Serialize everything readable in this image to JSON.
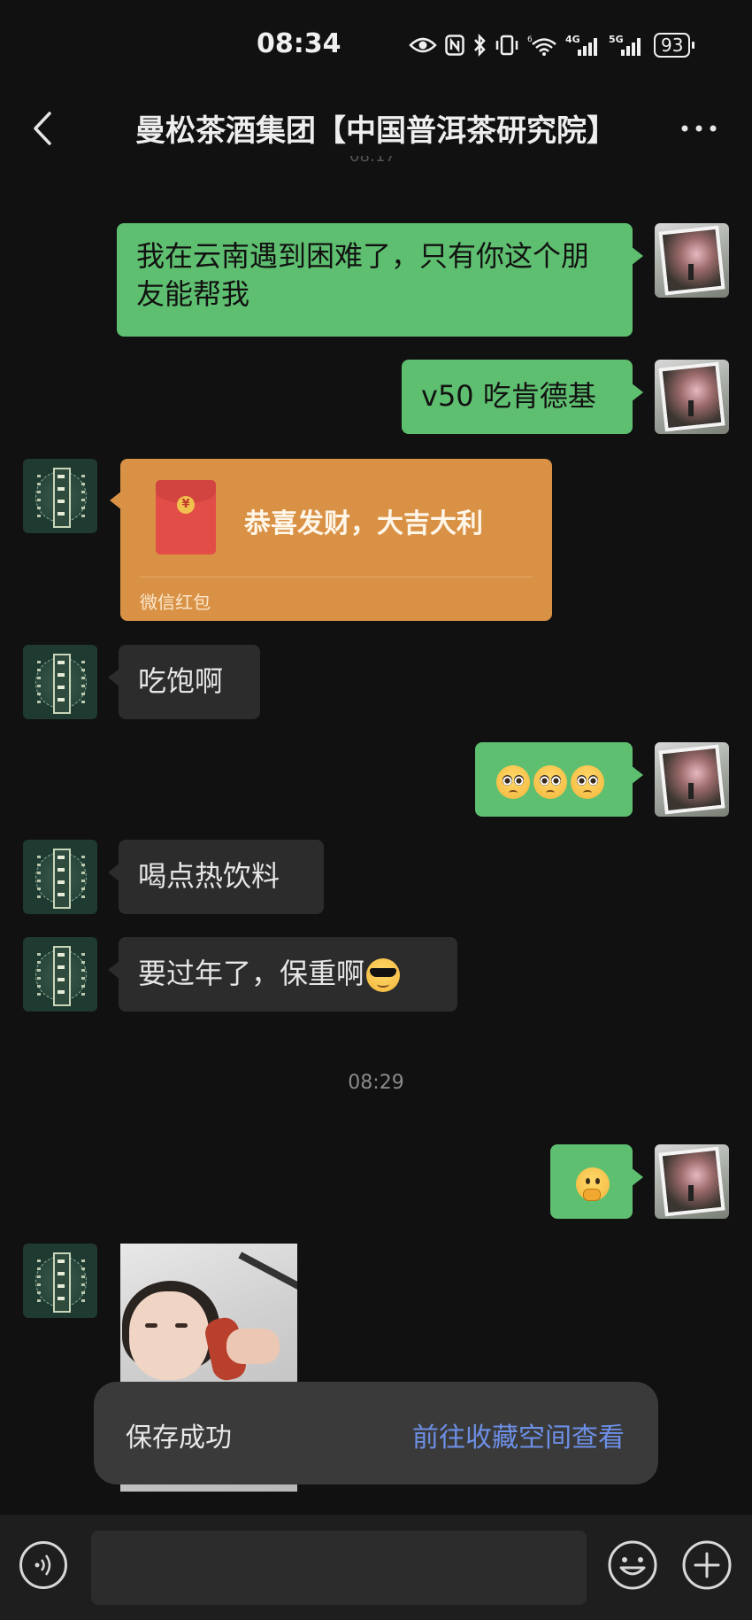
{
  "status_bar": {
    "time": "08:34",
    "signal_4g": "4G",
    "signal_5g": "5G",
    "battery": "93",
    "icons": [
      "eye-icon",
      "nfc-icon",
      "bluetooth-icon",
      "vibrate-icon",
      "wifi-icon",
      "signal-icon"
    ]
  },
  "header": {
    "title": "曼松茶酒集团【中国普洱茶研究院】",
    "faded_time": "08:17",
    "back_icon": "chevron-left-icon",
    "more_icon": "more-dots-icon"
  },
  "messages": [
    {
      "side": "self",
      "type": "text",
      "text": "我在云南遇到困难了，只有你这个朋友能帮我"
    },
    {
      "side": "self",
      "type": "text",
      "text": "v50 吃肯德基"
    },
    {
      "side": "other",
      "type": "red_packet",
      "title": "恭喜发财，大吉大利",
      "label": "微信红包"
    },
    {
      "side": "other",
      "type": "text",
      "text": "吃饱啊"
    },
    {
      "side": "self",
      "type": "emoji",
      "emojis": [
        "pleading-face",
        "pleading-face",
        "pleading-face"
      ]
    },
    {
      "side": "other",
      "type": "text",
      "text": "喝点热饮料"
    },
    {
      "side": "other",
      "type": "text",
      "text": "要过年了，保重啊",
      "emoji": "sunglasses-face"
    },
    {
      "side": "self",
      "type": "emoji",
      "emojis": [
        "thinking-face"
      ]
    },
    {
      "side": "other",
      "type": "image",
      "description_icon": "photo-image"
    }
  ],
  "timestamp": "08:29",
  "toast": {
    "text": "保存成功",
    "link": "前往收藏空间查看"
  },
  "input_bar": {
    "placeholder": "",
    "voice_icon": "voice-icon",
    "emoji_icon": "emoji-icon",
    "plus_icon": "plus-icon"
  },
  "colors": {
    "background": "#111111",
    "self_bubble": "#5fbf70",
    "other_bubble": "#2c2c2c",
    "red_packet": "#d99245",
    "toast_link": "#6d8fe6"
  }
}
